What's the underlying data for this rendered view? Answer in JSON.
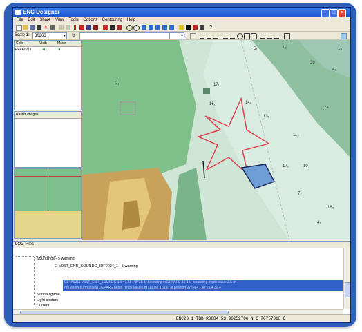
{
  "window": {
    "title": "ENC Designer"
  },
  "menu": [
    "File",
    "Edit",
    "Share",
    "View",
    "Tools",
    "Options",
    "Contouring",
    "Help"
  ],
  "toolbar": {
    "scale_label": "Scale 1:",
    "scale_value": "30263"
  },
  "cells_panel": {
    "columns": [
      "Cells",
      "Visib",
      "Mode"
    ],
    "rows": [
      {
        "name": "EE4A0211"
      }
    ]
  },
  "raster_panel": {
    "title": "Raster Images"
  },
  "map": {
    "labels": [
      "17₁",
      "16₁",
      "14₄",
      "13₆",
      "11₃",
      "4₁",
      "17₂",
      "7₂",
      "4₇",
      "18₃",
      "3b",
      "2a",
      "2₁",
      "10",
      "5₁",
      "1₂",
      "1₅"
    ]
  },
  "log_panel": {
    "title": "LOG Files",
    "items": [
      "Soundings - 5 warning",
      "V0ST_ENR_SOUNDG_IDF0024_1 - 5 warning",
      "Nonnavigable",
      "Light sectors",
      "Current"
    ],
    "selected_lines": [
      "EE4A0211 V0ST_ENR_SOUNDG 1 S=7.21 (48°21.4) Sounding in DEPARE 10-15 - sounding depth value 2.5 m",
      "not within surrounding DEPARE depth range values of [10.00, 15.00] at position 27.04.4 / 38°21.4 32.4"
    ]
  },
  "status": {
    "text": "ENC23  1  TBB  R0884 53 96252786 N   6 70757318 E"
  }
}
